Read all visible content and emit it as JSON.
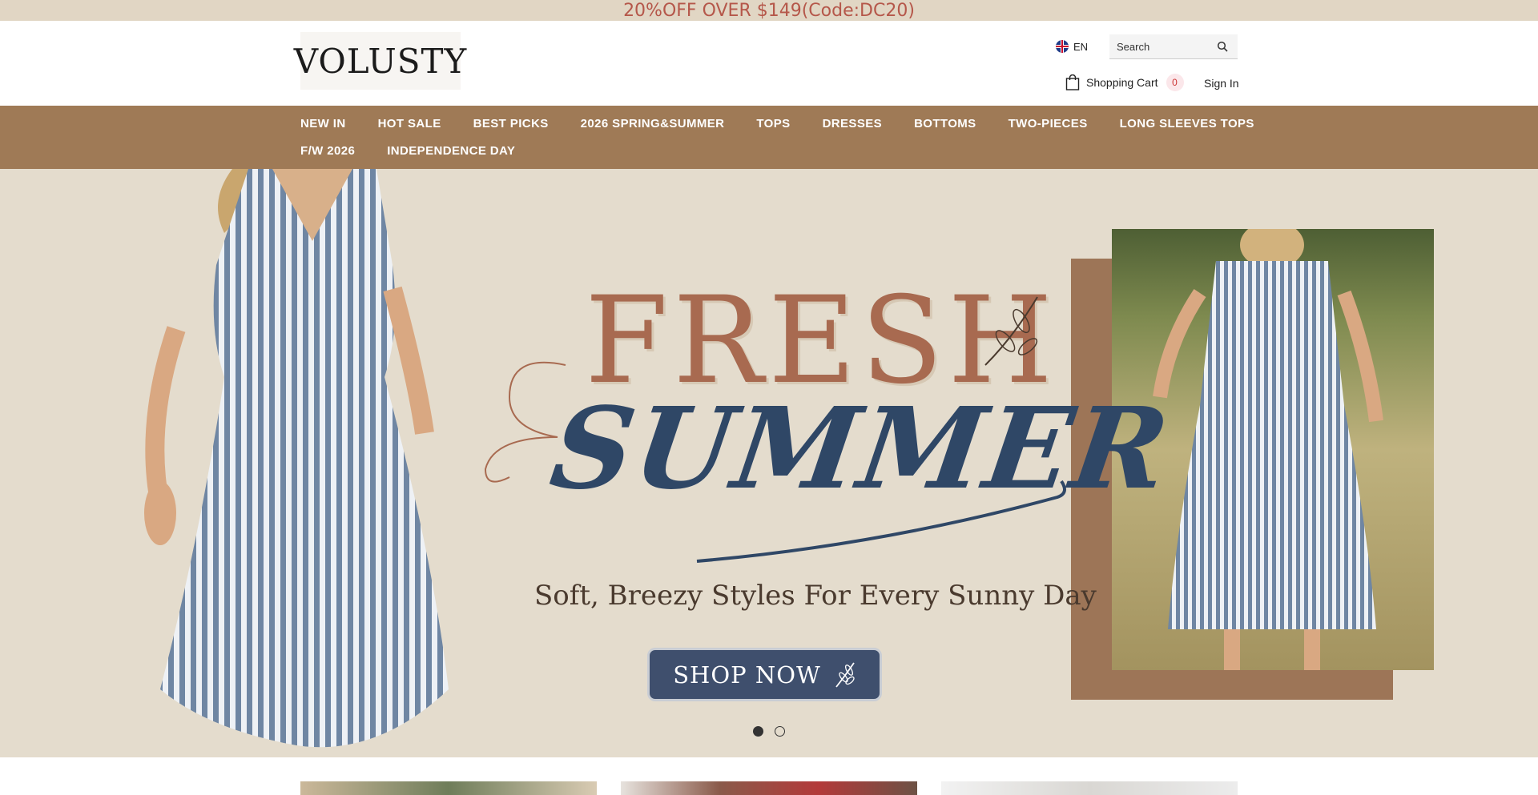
{
  "promo": {
    "text": "20%OFF OVER $149(Code:DC20)"
  },
  "header": {
    "logo_text": "VOLUSTY",
    "language": "EN",
    "search_placeholder": "Search",
    "cart_label": "Shopping Cart",
    "cart_count": "0",
    "signin_label": "Sign In"
  },
  "nav": {
    "row1": [
      "NEW IN",
      "HOT SALE",
      "BEST PICKS",
      "2026 SPRING&SUMMER",
      "TOPS",
      "DRESSES",
      "BOTTOMS",
      "TWO-PIECES",
      "LONG SLEEVES TOPS"
    ],
    "row2": [
      "F/W 2026",
      "INDEPENDENCE DAY"
    ]
  },
  "hero": {
    "title_line1": "FRESH",
    "title_line2": "SUMMER",
    "tagline": "Soft, Breezy Styles For Every Sunny Day",
    "cta_label": "SHOP NOW",
    "slides_total": 2,
    "active_slide": 1
  },
  "colors": {
    "promo_bg": "#e1d6c4",
    "promo_text": "#b5574a",
    "nav_bg": "#9f7a56",
    "hero_bg": "#e4dccd",
    "fresh_color": "#a86a50",
    "summer_color": "#2f4766",
    "cta_bg": "#3f4f6d"
  }
}
